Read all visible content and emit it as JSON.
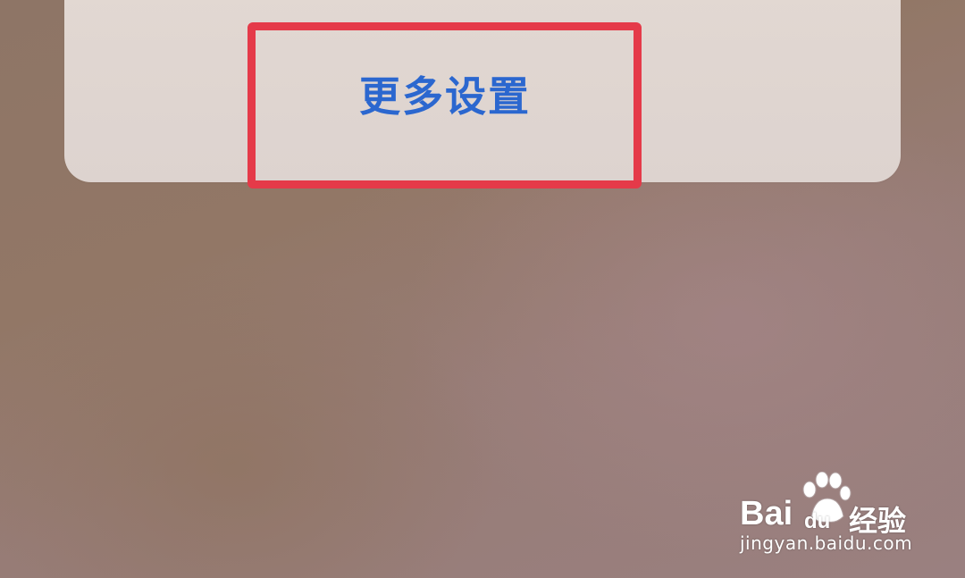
{
  "dialog": {
    "more_settings_label": "更多设置"
  },
  "icons": {
    "top_right": "connection-status-icon"
  },
  "annotation": {
    "highlight_color": "#e53a49"
  },
  "watermark": {
    "brand_latin_1": "Bai",
    "brand_latin_2": "du",
    "brand_cn": "经验",
    "url": "jingyan.baidu.com"
  },
  "colors": {
    "link_blue": "#2b67cf",
    "sheet_bg": "#ddd3cf"
  }
}
